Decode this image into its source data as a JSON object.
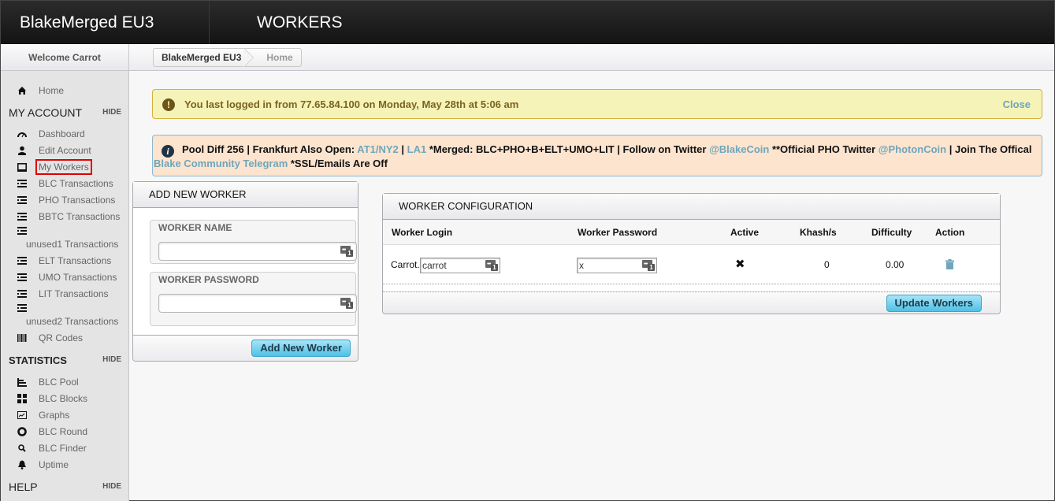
{
  "header": {
    "brand": "BlakeMerged EU3",
    "page_title": "WORKERS"
  },
  "sidebar": {
    "welcome": "Welcome Carrot",
    "home": {
      "label": "Home",
      "icon": "home-icon"
    },
    "sections": [
      {
        "title": "MY ACCOUNT",
        "hide_label": "HIDE",
        "items": [
          {
            "label": "Dashboard",
            "icon": "dashboard-icon"
          },
          {
            "label": "Edit Account",
            "icon": "user-icon"
          },
          {
            "label": "My Workers",
            "icon": "monitor-icon",
            "active": true
          },
          {
            "label": "BLC Transactions",
            "icon": "list-icon"
          },
          {
            "label": "PHO Transactions",
            "icon": "list-icon"
          },
          {
            "label": "BBTC Transactions",
            "icon": "list-icon"
          },
          {
            "label": "unused1 Transactions",
            "icon": "list-icon"
          },
          {
            "label": "ELT Transactions",
            "icon": "list-icon"
          },
          {
            "label": "UMO Transactions",
            "icon": "list-icon"
          },
          {
            "label": "LIT Transactions",
            "icon": "list-icon"
          },
          {
            "label": "unused2 Transactions",
            "icon": "list-icon"
          },
          {
            "label": "QR Codes",
            "icon": "barcode-icon"
          }
        ]
      },
      {
        "title": "STATISTICS",
        "hide_label": "HIDE",
        "items": [
          {
            "label": "BLC Pool",
            "icon": "bar-chart-icon"
          },
          {
            "label": "BLC Blocks",
            "icon": "grid-icon"
          },
          {
            "label": "Graphs",
            "icon": "line-graph-icon"
          },
          {
            "label": "BLC Round",
            "icon": "circle-icon"
          },
          {
            "label": "BLC Finder",
            "icon": "search-icon"
          },
          {
            "label": "Uptime",
            "icon": "bell-icon"
          }
        ]
      },
      {
        "title": "HELP",
        "hide_label": "HIDE",
        "items": []
      }
    ]
  },
  "breadcrumb": [
    "BlakeMerged EU3",
    "Home"
  ],
  "alerts": {
    "login": {
      "message": "You last logged in from 77.65.84.100 on Monday, May 28th at 5:06 am",
      "close_label": "Close"
    },
    "info": {
      "parts": [
        {
          "text": "Pool Diff 256 | Frankfurt Also Open: ",
          "link": false
        },
        {
          "text": "AT1/NY2",
          "link": true
        },
        {
          "text": " | ",
          "link": false
        },
        {
          "text": "LA1",
          "link": true
        },
        {
          "text": " *Merged: BLC+PHO+B+ELT+UMO+LIT | Follow on Twitter ",
          "link": false
        },
        {
          "text": "@BlakeCoin",
          "link": true
        },
        {
          "text": " **Official PHO Twitter ",
          "link": false
        },
        {
          "text": "@PhotonCoin",
          "link": true
        },
        {
          "text": " | Join The Offical ",
          "link": false
        },
        {
          "text": "Blake Community Telegram",
          "link": true
        },
        {
          "text": " *SSL/Emails Are Off",
          "link": false
        }
      ]
    }
  },
  "add_worker": {
    "title": "ADD NEW WORKER",
    "name_label": "WORKER NAME",
    "name_value": "",
    "password_label": "WORKER PASSWORD",
    "password_value": "",
    "submit_label": "Add New Worker"
  },
  "worker_config": {
    "title": "WORKER CONFIGURATION",
    "columns": [
      "Worker Login",
      "Worker Password",
      "Active",
      "Khash/s",
      "Difficulty",
      "Action"
    ],
    "rows": [
      {
        "login_prefix": "Carrot.",
        "login_value": "carrot",
        "password_value": "x",
        "active": false,
        "active_symbol": "✖",
        "khash": "0",
        "difficulty": "0.00",
        "action_icon": "trash-icon"
      }
    ],
    "update_label": "Update Workers"
  },
  "colors": {
    "accent_button": "#4fc1e6",
    "link": "#6fa6bb",
    "login_alert_bg": "#f6f3b8",
    "info_alert_bg": "#fde4cf",
    "active_highlight": "#e00000"
  }
}
